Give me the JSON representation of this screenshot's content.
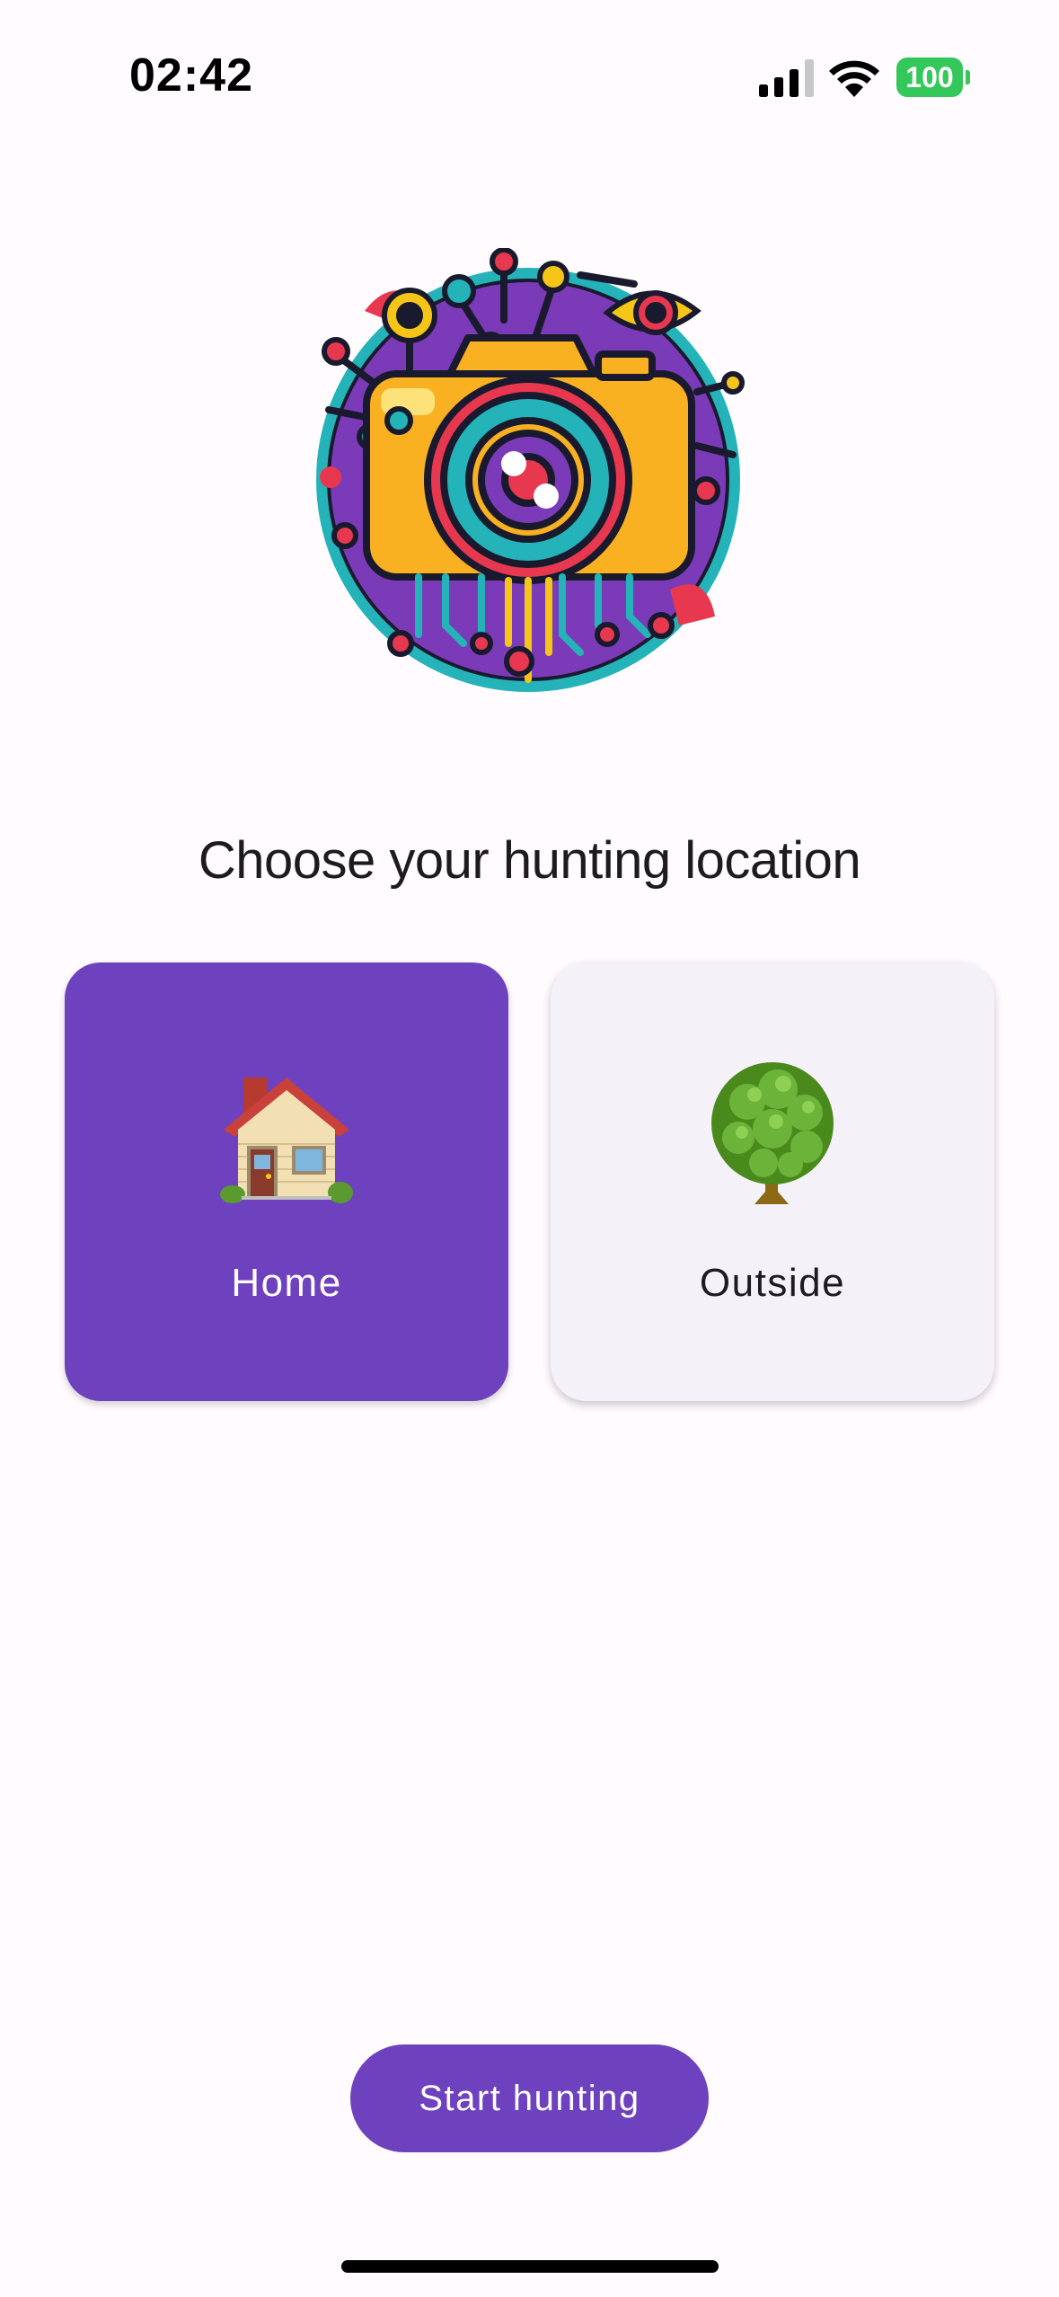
{
  "status_bar": {
    "time": "02:42",
    "battery_level": "100",
    "battery_color": "#34c759",
    "icons": [
      "signal-icon",
      "wifi-icon",
      "battery-icon"
    ]
  },
  "logo": {
    "icon": "camera-circuit-logo"
  },
  "main": {
    "heading": "Choose your hunting location",
    "options": [
      {
        "label": "Home",
        "icon": "house-icon",
        "selected": true
      },
      {
        "label": "Outside",
        "icon": "tree-icon",
        "selected": false
      }
    ]
  },
  "actions": {
    "start_label": "Start hunting"
  },
  "colors": {
    "accent": "#6e41be",
    "card_unselected": "#f4f1f8",
    "background": "#fffbfe"
  }
}
